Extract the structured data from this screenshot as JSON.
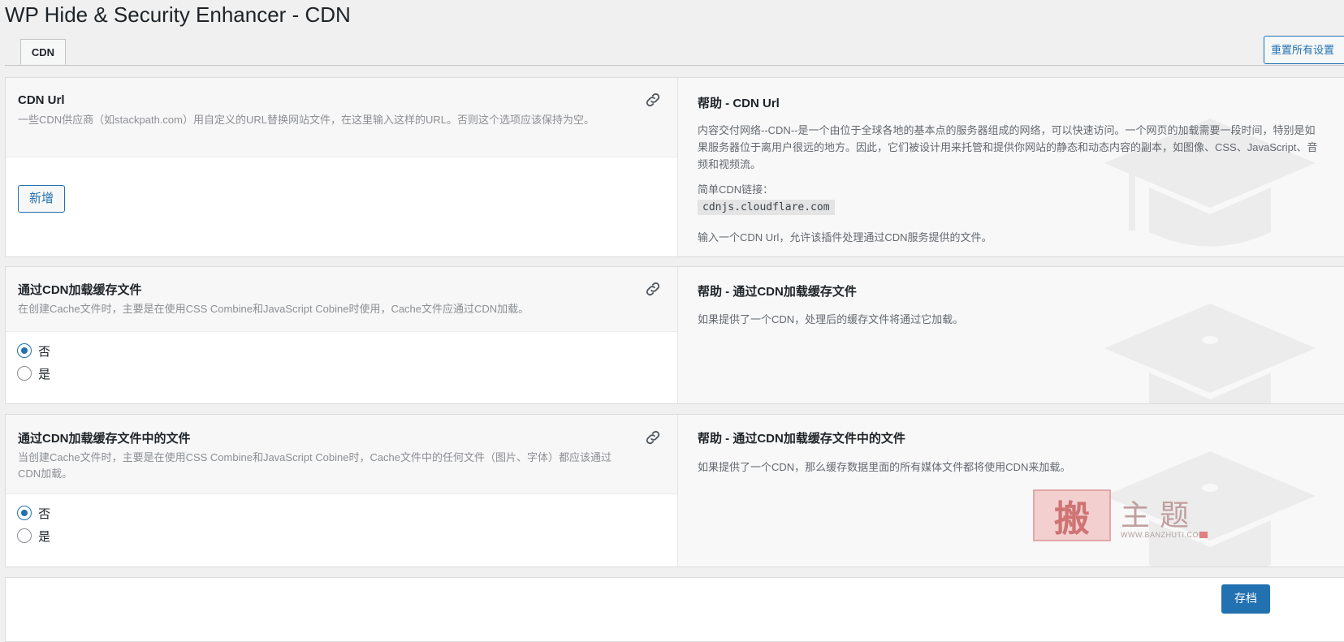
{
  "page": {
    "title": "WP Hide & Security Enhancer - CDN"
  },
  "tabs": [
    {
      "label": "CDN",
      "active": true
    }
  ],
  "header": {
    "reset_label": "重置所有设置"
  },
  "options": [
    {
      "title": "CDN Url",
      "desc": "一些CDN供应商（如stackpath.com）用自定义的URL替换网站文件，在这里输入这样的URL。否则这个选项应该保持为空。",
      "add_label": "新增",
      "help_title": "帮助 - CDN Url",
      "help_text": "内容交付网络--CDN--是一个由位于全球各地的基本点的服务器组成的网络，可以快速访问。一个网页的加载需要一段时间，特别是如果服务器位于离用户很远的地方。因此，它们被设计用来托管和提供你网站的静态和动态内容的副本，如图像、CSS、JavaScript、音频和视频流。",
      "help_example_label": "简单CDN链接：",
      "help_example_code": "cdnjs.cloudflare.com",
      "help_note": "输入一个CDN Url，允许该插件处理通过CDN服务提供的文件。"
    },
    {
      "title": "通过CDN加载缓存文件",
      "desc": "在创建Cache文件时，主要是在使用CSS Combine和JavaScript Cobine时使用，Cache文件应通过CDN加载。",
      "radios": [
        {
          "label": "否",
          "checked": true
        },
        {
          "label": "是",
          "checked": false
        }
      ],
      "help_title": "帮助 - 通过CDN加载缓存文件",
      "help_text": "如果提供了一个CDN，处理后的缓存文件将通过它加载。"
    },
    {
      "title": "通过CDN加载缓存文件中的文件",
      "desc": "当创建Cache文件时，主要是在使用CSS Combine和JavaScript Cobine时，Cache文件中的任何文件（图片、字体）都应该通过CDN加载。",
      "radios": [
        {
          "label": "否",
          "checked": true
        },
        {
          "label": "是",
          "checked": false
        }
      ],
      "help_title": "帮助 - 通过CDN加载缓存文件中的文件",
      "help_text": "如果提供了一个CDN，那么缓存数据里面的所有媒体文件都将使用CDN来加载。"
    }
  ],
  "footer": {
    "save_label": "存档"
  },
  "watermark": {
    "stamp": "搬",
    "text": "主题",
    "url": "WWW.BANZHUTI.COM"
  },
  "colors": {
    "accent": "#2271b1",
    "background": "#f0f0f1",
    "panel": "#ffffff",
    "help_panel": "#f8f8f8"
  }
}
